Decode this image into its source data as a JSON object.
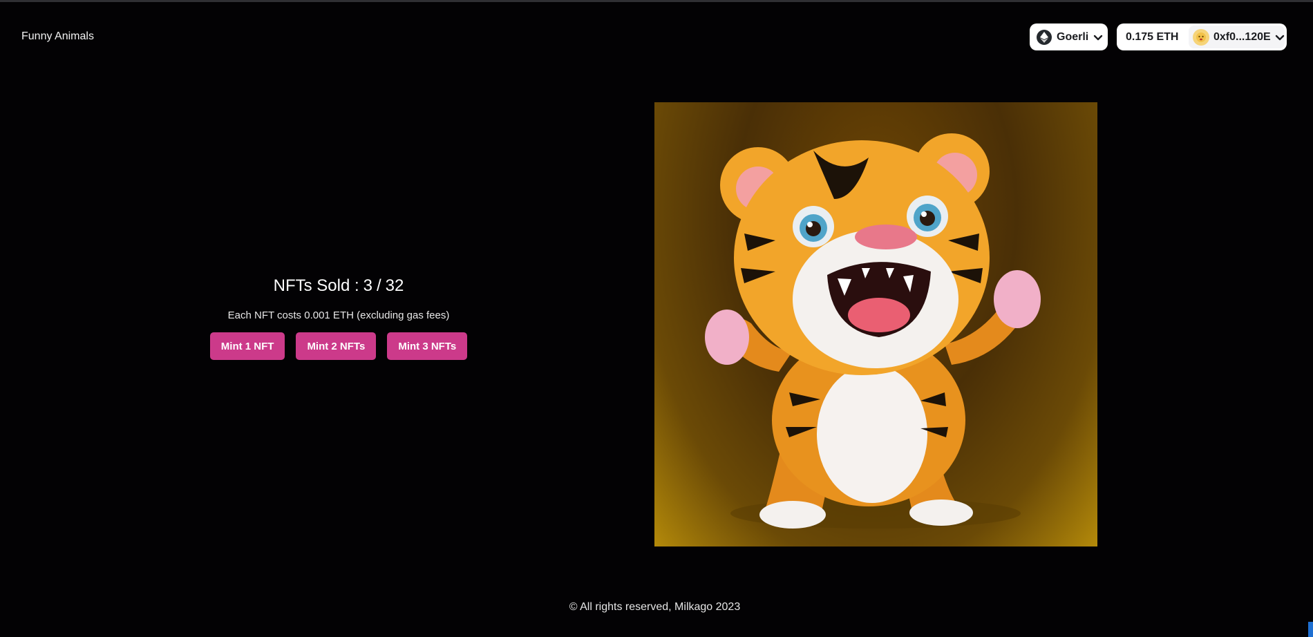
{
  "header": {
    "brand": "Funny Animals"
  },
  "wallet": {
    "network": "Goerli",
    "balance": "0.175 ETH",
    "address": "0xf0...120E"
  },
  "mint": {
    "sold_label": "NFTs Sold :",
    "sold_count": "3",
    "separator": "/",
    "total_supply": "32",
    "cost_text": "Each NFT costs 0.001 ETH (excluding gas fees)",
    "buttons": [
      "Mint 1 NFT",
      "Mint 2 NFTs",
      "Mint 3 NFTs"
    ]
  },
  "footer": {
    "text": "© All rights reserved, Milkago 2023"
  },
  "colors": {
    "background": "#030204",
    "accent": "#cc3a8a",
    "wallet_button": "#ffffff"
  },
  "icons": {
    "network": "ethereum-icon",
    "dropdown": "chevron-down-icon",
    "avatar": "account-avatar-icon"
  }
}
